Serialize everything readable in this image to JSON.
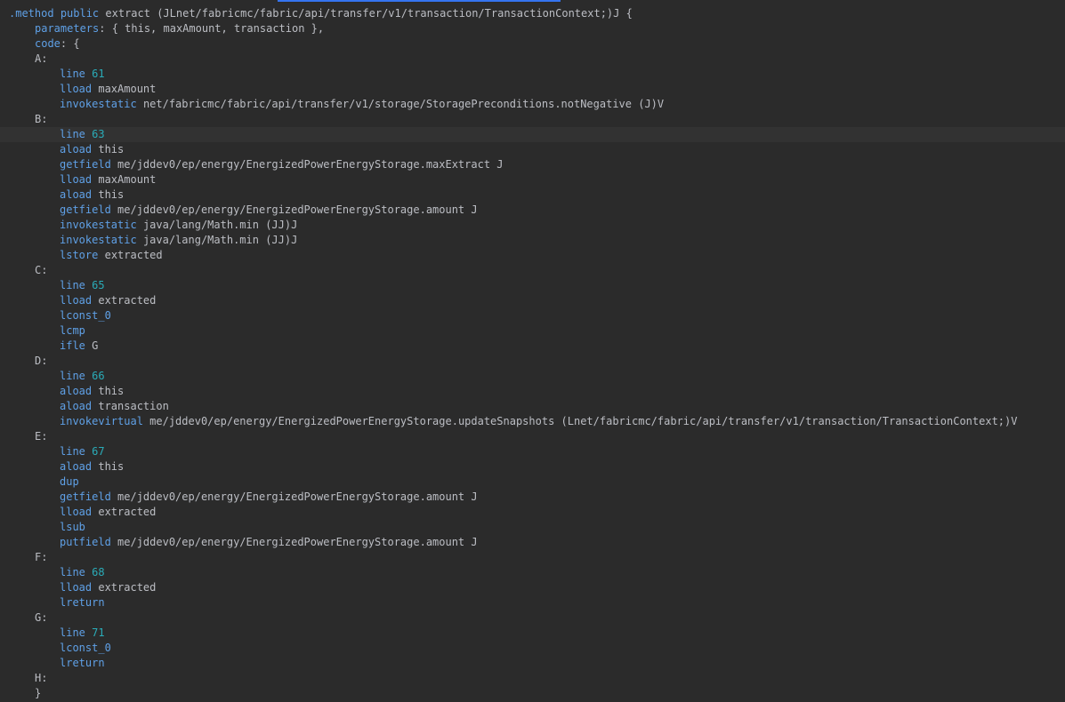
{
  "colors": {
    "background": "#2b2b2b",
    "keyword": "#5fa0e6",
    "number": "#2aacb8",
    "text": "#bcbec4",
    "current_line": "#323232",
    "tab_indicator": "#3574f0"
  },
  "header": {
    "dot_method": ".method",
    "public": "public",
    "signature": "extract (JLnet/fabricmc/fabric/api/transfer/v1/transaction/TransactionContext;)J {",
    "parameters_key": "parameters",
    "parameters_value": ": { this, maxAmount, transaction },",
    "code_key": "code",
    "code_value": ": {"
  },
  "lines": [
    {
      "label": "A:"
    },
    {
      "op": "line",
      "arg": "61",
      "num": true
    },
    {
      "op": "lload",
      "arg": "maxAmount"
    },
    {
      "op": "invokestatic",
      "arg": "net/fabricmc/fabric/api/transfer/v1/storage/StoragePreconditions.notNegative (J)V"
    },
    {
      "label": "B:"
    },
    {
      "op": "line",
      "arg": "63",
      "num": true,
      "highlight": true
    },
    {
      "op": "aload",
      "arg": "this"
    },
    {
      "op": "getfield",
      "arg": "me/jddev0/ep/energy/EnergizedPowerEnergyStorage.maxExtract J"
    },
    {
      "op": "lload",
      "arg": "maxAmount"
    },
    {
      "op": "aload",
      "arg": "this"
    },
    {
      "op": "getfield",
      "arg": "me/jddev0/ep/energy/EnergizedPowerEnergyStorage.amount J"
    },
    {
      "op": "invokestatic",
      "arg": "java/lang/Math.min (JJ)J"
    },
    {
      "op": "invokestatic",
      "arg": "java/lang/Math.min (JJ)J"
    },
    {
      "op": "lstore",
      "arg": "extracted"
    },
    {
      "label": "C:"
    },
    {
      "op": "line",
      "arg": "65",
      "num": true
    },
    {
      "op": "lload",
      "arg": "extracted"
    },
    {
      "op": "lconst_0",
      "arg": ""
    },
    {
      "op": "lcmp",
      "arg": ""
    },
    {
      "op": "ifle",
      "arg": "G"
    },
    {
      "label": "D:"
    },
    {
      "op": "line",
      "arg": "66",
      "num": true
    },
    {
      "op": "aload",
      "arg": "this"
    },
    {
      "op": "aload",
      "arg": "transaction"
    },
    {
      "op": "invokevirtual",
      "arg": "me/jddev0/ep/energy/EnergizedPowerEnergyStorage.updateSnapshots (Lnet/fabricmc/fabric/api/transfer/v1/transaction/TransactionContext;)V"
    },
    {
      "label": "E:"
    },
    {
      "op": "line",
      "arg": "67",
      "num": true
    },
    {
      "op": "aload",
      "arg": "this"
    },
    {
      "op": "dup",
      "arg": ""
    },
    {
      "op": "getfield",
      "arg": "me/jddev0/ep/energy/EnergizedPowerEnergyStorage.amount J"
    },
    {
      "op": "lload",
      "arg": "extracted"
    },
    {
      "op": "lsub",
      "arg": ""
    },
    {
      "op": "putfield",
      "arg": "me/jddev0/ep/energy/EnergizedPowerEnergyStorage.amount J"
    },
    {
      "label": "F:"
    },
    {
      "op": "line",
      "arg": "68",
      "num": true
    },
    {
      "op": "lload",
      "arg": "extracted"
    },
    {
      "op": "lreturn",
      "arg": ""
    },
    {
      "label": "G:"
    },
    {
      "op": "line",
      "arg": "71",
      "num": true
    },
    {
      "op": "lconst_0",
      "arg": ""
    },
    {
      "op": "lreturn",
      "arg": ""
    },
    {
      "label": "H:"
    }
  ],
  "footer": {
    "close_brace": "}"
  }
}
